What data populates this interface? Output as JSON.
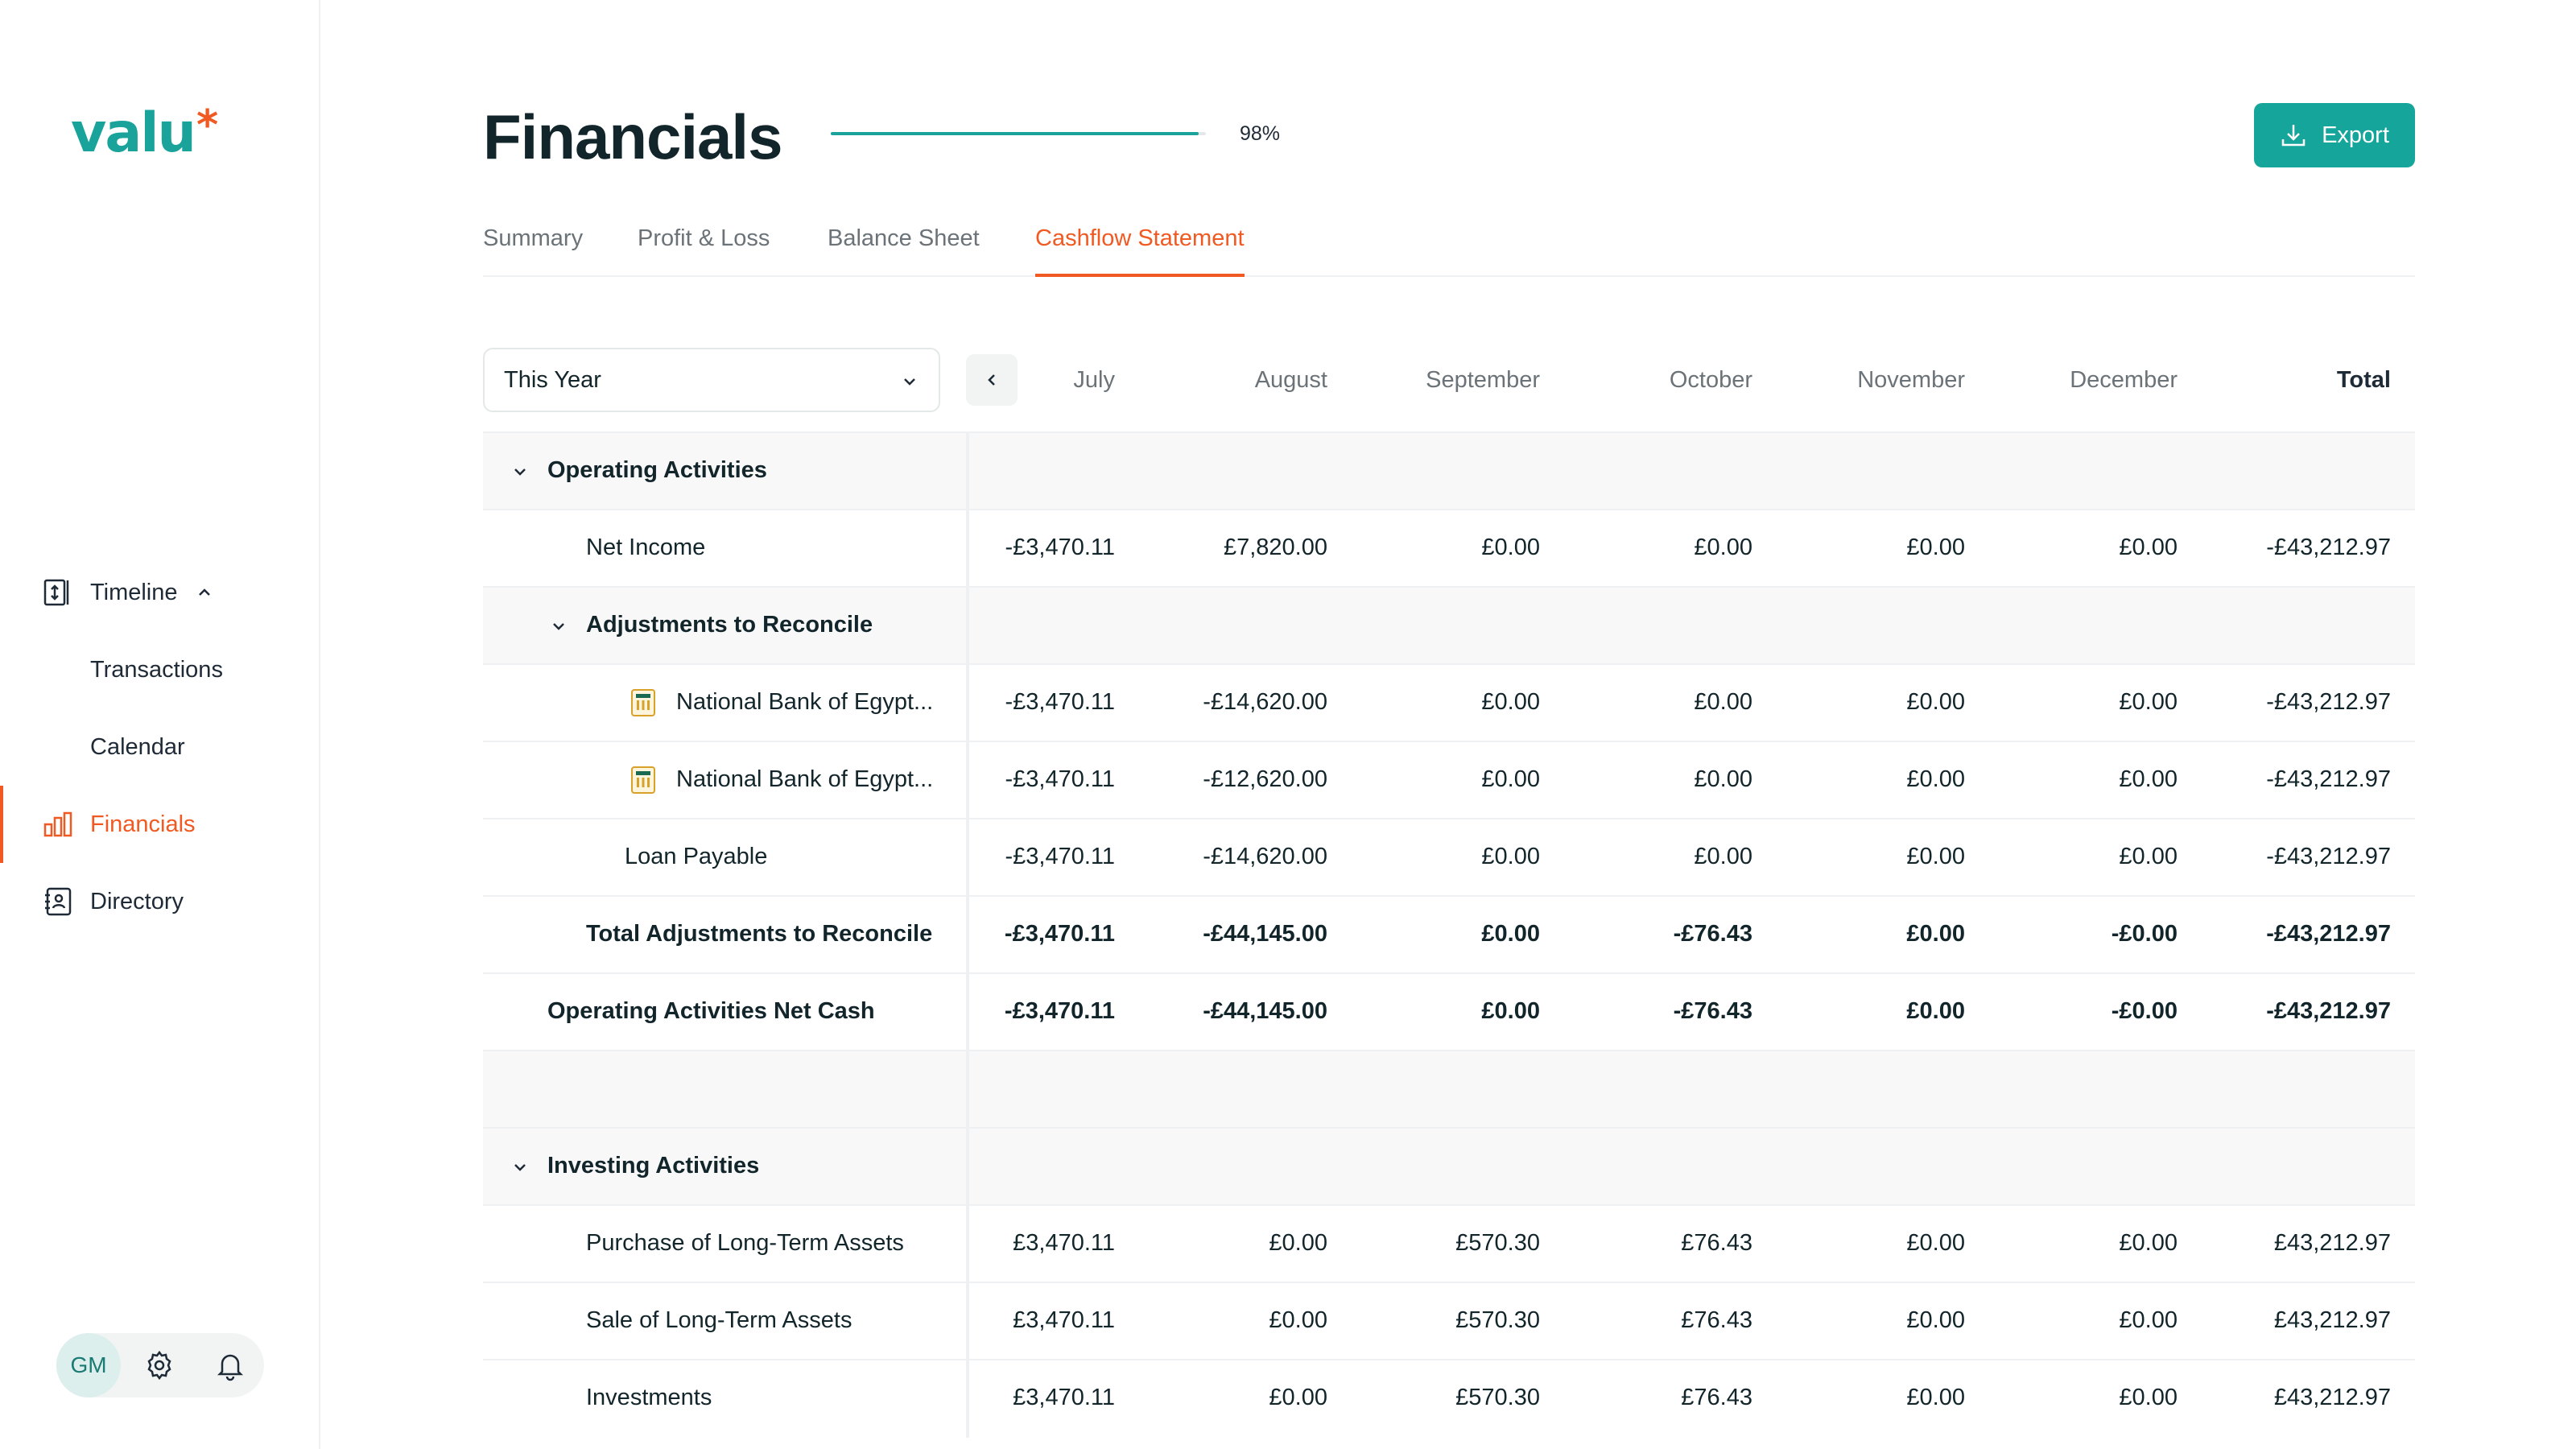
{
  "app": {
    "logo_text": "valu",
    "logo_star": "*",
    "colors": {
      "brand": "#19a39a",
      "accent": "#f05a22",
      "text": "#12252b"
    }
  },
  "sidebar": {
    "items": [
      {
        "label": "Timeline",
        "icon": "timeline-icon"
      },
      {
        "label": "Transactions"
      },
      {
        "label": "Calendar"
      },
      {
        "label": "Financials",
        "icon": "bar-chart-icon",
        "active": true
      },
      {
        "label": "Directory",
        "icon": "directory-icon"
      }
    ],
    "user": {
      "initials": "GM"
    }
  },
  "header": {
    "title": "Financials",
    "progress_pct": "98%",
    "progress_value": 0.98,
    "export_label": "Export"
  },
  "tabs": [
    {
      "label": "Summary"
    },
    {
      "label": "Profit & Loss"
    },
    {
      "label": "Balance Sheet"
    },
    {
      "label": "Cashflow Statement",
      "active": true
    }
  ],
  "table": {
    "period": "This Year",
    "columns": [
      "July",
      "August",
      "September",
      "October",
      "November",
      "December",
      "Total"
    ],
    "rows": [
      {
        "label": "Operating Activities",
        "type": "section",
        "values": []
      },
      {
        "label": "Net Income",
        "values": [
          "-£3,470.11",
          "£7,820.00",
          "£0.00",
          "£0.00",
          "£0.00",
          "£0.00",
          "-£43,212.97"
        ]
      },
      {
        "label": "Adjustments to Reconcile",
        "type": "subsection",
        "values": []
      },
      {
        "label": "National Bank of Egypt...",
        "icon": "bank-icon",
        "values": [
          "-£3,470.11",
          "-£14,620.00",
          "£0.00",
          "£0.00",
          "£0.00",
          "£0.00",
          "-£43,212.97"
        ]
      },
      {
        "label": "National Bank of Egypt...",
        "icon": "bank-icon",
        "values": [
          "-£3,470.11",
          "-£12,620.00",
          "£0.00",
          "£0.00",
          "£0.00",
          "£0.00",
          "-£43,212.97"
        ]
      },
      {
        "label": "Loan Payable",
        "values": [
          "-£3,470.11",
          "-£14,620.00",
          "£0.00",
          "£0.00",
          "£0.00",
          "£0.00",
          "-£43,212.97"
        ]
      },
      {
        "label": "Total Adjustments to Reconcile",
        "type": "bold",
        "values": [
          "-£3,470.11",
          "-£44,145.00",
          "£0.00",
          "-£76.43",
          "£0.00",
          "-£0.00",
          "-£43,212.97"
        ]
      },
      {
        "label": "Operating Activities Net Cash",
        "type": "bold",
        "values": [
          "-£3,470.11",
          "-£44,145.00",
          "£0.00",
          "-£76.43",
          "£0.00",
          "-£0.00",
          "-£43,212.97"
        ]
      },
      {
        "label": "",
        "type": "spacer",
        "values": []
      },
      {
        "label": "Investing Activities",
        "type": "section",
        "values": []
      },
      {
        "label": "Purchase of Long-Term Assets",
        "values": [
          "£3,470.11",
          "£0.00",
          "£570.30",
          "£76.43",
          "£0.00",
          "£0.00",
          "£43,212.97"
        ]
      },
      {
        "label": "Sale of Long-Term Assets",
        "values": [
          "£3,470.11",
          "£0.00",
          "£570.30",
          "£76.43",
          "£0.00",
          "£0.00",
          "£43,212.97"
        ]
      },
      {
        "label": "Investments",
        "values": [
          "£3,470.11",
          "£0.00",
          "£570.30",
          "£76.43",
          "£0.00",
          "£0.00",
          "£43,212.97"
        ]
      }
    ]
  }
}
